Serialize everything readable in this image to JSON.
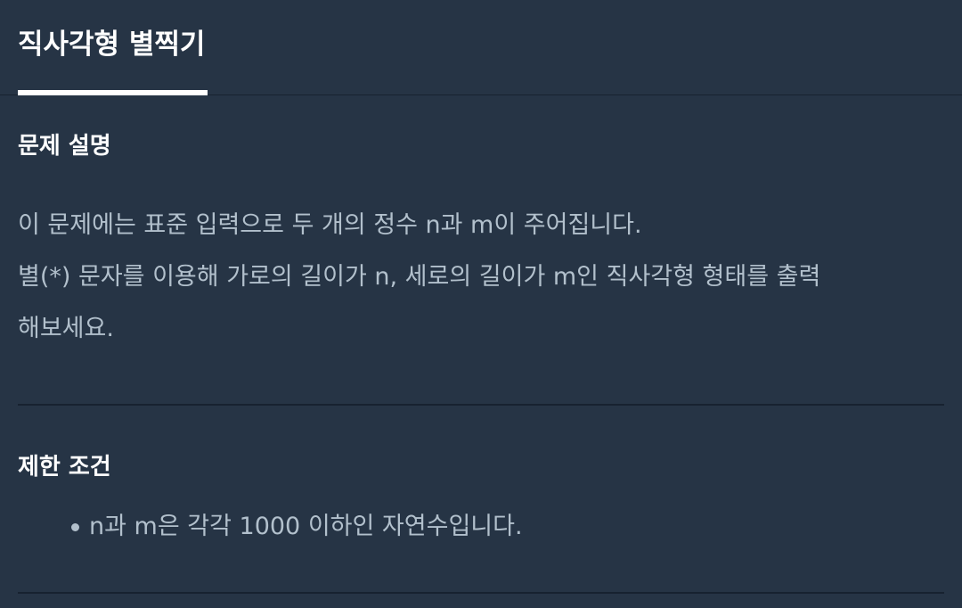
{
  "tabs": [
    {
      "label": "직사각형 별찍기",
      "active": true
    }
  ],
  "description": {
    "title": "문제 설명",
    "lines": [
      "이 문제에는 표준 입력으로 두 개의 정수 n과 m이 주어집니다.",
      "별(*) 문자를 이용해 가로의 길이가 n, 세로의 길이가 m인 직사각형 형태를 출력",
      "해보세요."
    ]
  },
  "limits": {
    "title": "제한 조건",
    "items": [
      "n과 m은 각각 1000 이하인 자연수입니다."
    ]
  },
  "colors": {
    "background": "#263445",
    "heading": "#ffffff",
    "body_text": "#b2c0cc",
    "divider": "#172230",
    "active_tab_indicator": "#ffffff"
  }
}
